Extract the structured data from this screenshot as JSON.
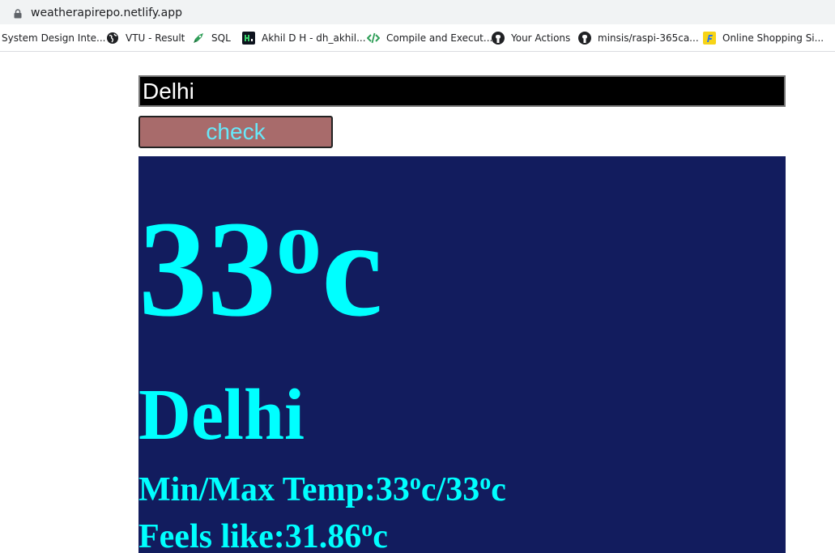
{
  "browser": {
    "url": "weatherapirepo.netlify.app",
    "bookmarks": [
      {
        "label": "System Design Inte...",
        "icon": "none"
      },
      {
        "label": "VTU - Result",
        "icon": "globe-icon"
      },
      {
        "label": "SQL",
        "icon": "rocket-icon"
      },
      {
        "label": "Akhil D H - dh_akhil...",
        "icon": "hackerrank-icon"
      },
      {
        "label": "Compile and Execut...",
        "icon": "code-icon"
      },
      {
        "label": "Your Actions",
        "icon": "github-icon"
      },
      {
        "label": "minsis/raspi-365ca...",
        "icon": "github-icon"
      },
      {
        "label": "Online Shopping Si...",
        "icon": "flipkart-icon"
      }
    ]
  },
  "app": {
    "input_value": "Delhi",
    "button_label": "check",
    "temperature": "33",
    "temp_unit_sup": "o",
    "temp_unit": "c",
    "city": "Delhi",
    "minmax_label": "Min/Max Temp:",
    "min_value": "33",
    "max_value": "33",
    "feels_label": "Feels like:",
    "feels_value": "31.86",
    "degree_sup": "o",
    "unit": "c",
    "separator": "/"
  },
  "colors": {
    "panel_bg": "#121c5e",
    "text_accent": "#00ffff",
    "button_bg": "#a86b6b",
    "button_text": "#67e8f9",
    "input_bg": "#000000"
  }
}
